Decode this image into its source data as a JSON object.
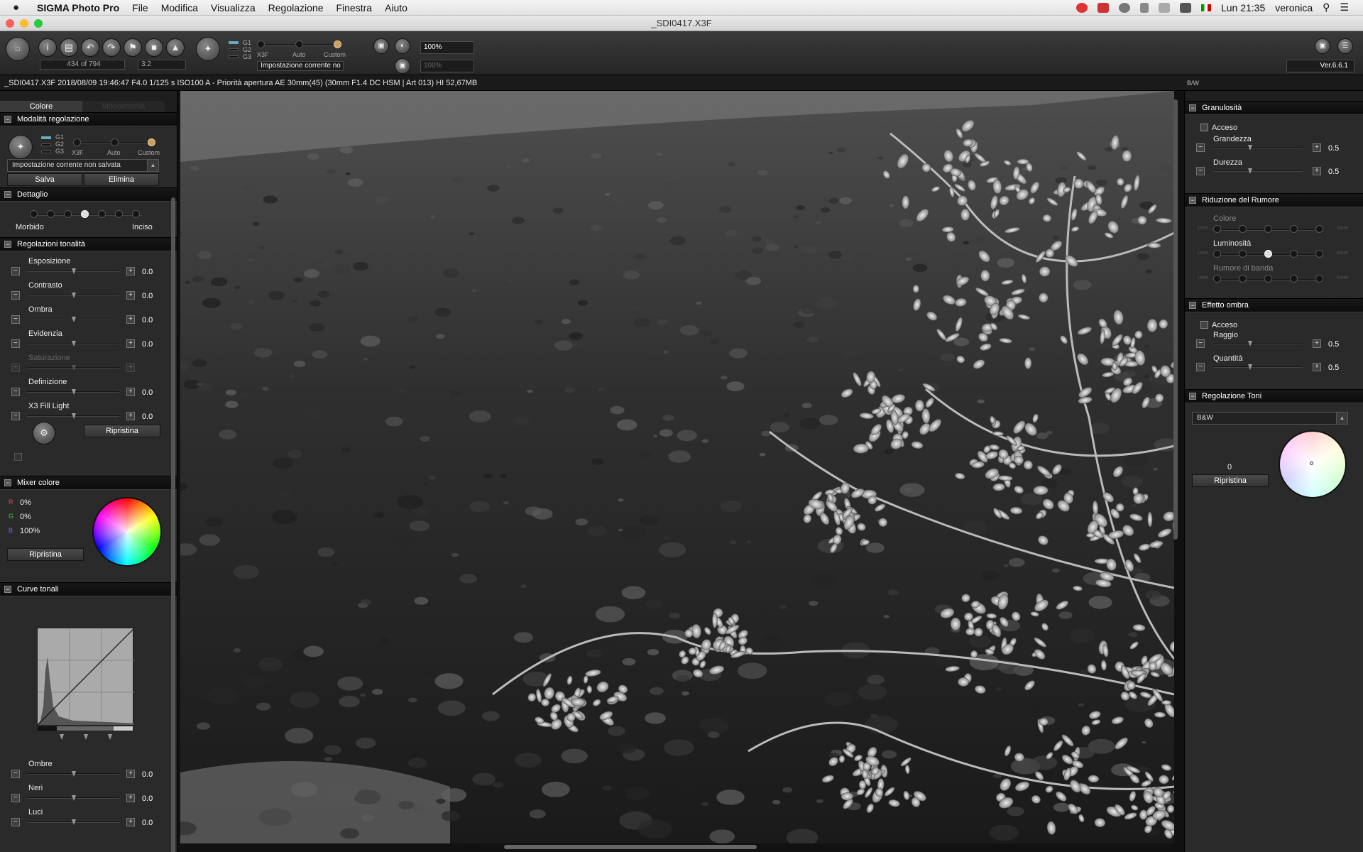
{
  "menubar": {
    "app": "SIGMA Photo Pro",
    "items": [
      "File",
      "Modifica",
      "Visualizza",
      "Regolazione",
      "Finestra",
      "Aiuto"
    ],
    "clock": "Lun 21:35",
    "user": "veronica"
  },
  "window": {
    "title": "_SDI0417.X3F"
  },
  "toolbar": {
    "counter": "434 of 794",
    "ratio": "3:2",
    "g_labels": [
      "G1",
      "G2",
      "G3"
    ],
    "mode_labels": [
      "X3F",
      "Auto",
      "Custom"
    ],
    "setting": "Impostazione corrente no",
    "zoom": "100%",
    "zoom2": "100%",
    "version": "Ver.6.6.1"
  },
  "infobar": {
    "text": "_SDI0417.X3F 2018/08/09 19:46:47 F4.0 1/125 s ISO100 A - Priorità apertura AE 30mm(45) (30mm F1.4 DC HSM | Art 013) HI 52,67MB",
    "bw": "B/W"
  },
  "left": {
    "tabs": [
      "Colore",
      "Monocromia"
    ],
    "mode_section": "Modalità regolazione",
    "g_labels": [
      "G1",
      "G2",
      "G3"
    ],
    "mode_labels": [
      "X3F",
      "Auto",
      "Custom"
    ],
    "preset": "Impostazione corrente non salvata",
    "save": "Salva",
    "delete": "Elimina",
    "detail_section": "Dettaglio",
    "detail_labels": [
      "Morbido",
      "Inciso"
    ],
    "detail_level": 3,
    "tone_section": "Regolazioni tonalità",
    "sliders": [
      {
        "label": "Esposizione",
        "value": "0.0"
      },
      {
        "label": "Contrasto",
        "value": "0.0"
      },
      {
        "label": "Ombra",
        "value": "0.0"
      },
      {
        "label": "Evidenzia",
        "value": "0.0"
      },
      {
        "label": "Saturazione",
        "value": ""
      },
      {
        "label": "Definizione",
        "value": "0.0"
      },
      {
        "label": "X3 Fill Light",
        "value": "0.0"
      }
    ],
    "reset": "Ripristina",
    "mixer_section": "Mixer colore",
    "mixer": [
      {
        "ch": "R",
        "value": "0%"
      },
      {
        "ch": "G",
        "value": "0%"
      },
      {
        "ch": "B",
        "value": "100%"
      }
    ],
    "mixer_reset": "Ripristina",
    "curve_section": "Curve tonali",
    "curve_sliders": [
      {
        "label": "Ombre",
        "value": "0.0"
      },
      {
        "label": "Neri",
        "value": "0.0"
      },
      {
        "label": "Luci",
        "value": "0.0"
      }
    ]
  },
  "right": {
    "grain_section": "Granulosità",
    "grain_on": "Acceso",
    "grain": [
      {
        "label": "Grandezza",
        "value": "0.5"
      },
      {
        "label": "Durezza",
        "value": "0.5"
      }
    ],
    "noise_section": "Riduzione del Rumore",
    "noise": [
      {
        "label": "Colore",
        "level": 0
      },
      {
        "label": "Luminosità",
        "level": 2
      },
      {
        "label": "Rumore di banda",
        "level": 0
      }
    ],
    "noise_end": [
      "Less",
      "More"
    ],
    "shadow_section": "Effetto ombra",
    "shadow_on": "Acceso",
    "shadow": [
      {
        "label": "Raggio",
        "value": "0.5"
      },
      {
        "label": "Quantità",
        "value": "0.5"
      }
    ],
    "tone_section": "Regolazione Toni",
    "tone_select": "B&W",
    "tone_value": "0",
    "tone_reset": "Ripristina"
  },
  "colors": {
    "bg": "#2a2a2a",
    "section": "#111111",
    "accent": "#c8a060"
  }
}
